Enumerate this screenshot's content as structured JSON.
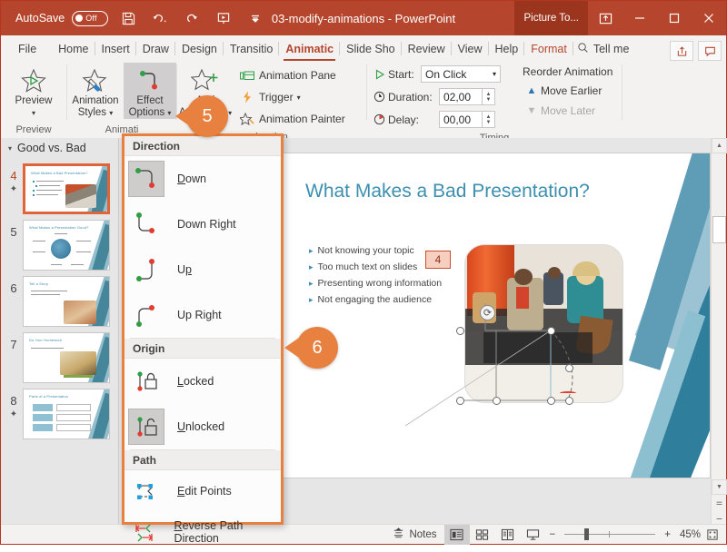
{
  "titlebar": {
    "autosave_label": "AutoSave",
    "autosave_state": "Off",
    "icons": [
      "save-icon",
      "undo-icon",
      "redo-icon",
      "start-slideshow-icon",
      "customize-quick-access-icon"
    ],
    "document_title": "03-modify-animations  -  PowerPoint",
    "contextual_tab": "Picture To...",
    "ribbon_display_options": "ribbon-display-icon",
    "minimize": "minimize-icon",
    "restore": "restore-icon",
    "close": "close-icon"
  },
  "tabs": [
    {
      "label": "File",
      "active": false
    },
    {
      "label": "Home",
      "active": false
    },
    {
      "label": "Insert",
      "active": false
    },
    {
      "label": "Draw",
      "active": false
    },
    {
      "label": "Design",
      "active": false
    },
    {
      "label": "Transitio",
      "active": false
    },
    {
      "label": "Animatic",
      "active": true
    },
    {
      "label": "Slide Sho",
      "active": false
    },
    {
      "label": "Review",
      "active": false
    },
    {
      "label": "View",
      "active": false
    },
    {
      "label": "Help",
      "active": false
    },
    {
      "label": "Format",
      "active": false,
      "contextual": true
    }
  ],
  "tellme": {
    "label": "Tell me",
    "icon": "search-icon",
    "share_icon": "share-icon",
    "comments_icon": "comments-icon"
  },
  "ribbon": {
    "groups": [
      {
        "name": "Preview",
        "label": "Preview",
        "buttons": [
          {
            "label": "Preview",
            "icon": "preview-star-icon",
            "dropdown": true
          }
        ]
      },
      {
        "name": "Animation",
        "label": "Animati",
        "buttons": [
          {
            "label": "Animation Styles",
            "icon": "animation-styles-icon",
            "dropdown": true
          },
          {
            "label": "Effect Options",
            "icon": "effect-options-icon",
            "dropdown": true,
            "selected": true
          }
        ]
      },
      {
        "name": "AdvancedAnimation",
        "label": "imation",
        "buttons": [
          {
            "label": "Add Animation",
            "icon": "add-animation-icon",
            "dropdown": true
          }
        ],
        "commands": [
          {
            "label": "Animation Pane",
            "icon": "animation-pane-icon"
          },
          {
            "label": "Trigger",
            "icon": "trigger-icon",
            "dropdown": true
          },
          {
            "label": "Animation Painter",
            "icon": "animation-painter-icon"
          }
        ]
      },
      {
        "name": "Timing",
        "label": "Timing",
        "fields": [
          {
            "label": "Start:",
            "value": "On Click",
            "icon": "play-icon",
            "type": "select"
          },
          {
            "label": "Duration:",
            "value": "02,00",
            "icon": "clock-icon",
            "type": "spinner"
          },
          {
            "label": "Delay:",
            "value": "00,00",
            "icon": "delay-clock-icon",
            "type": "spinner"
          }
        ],
        "reorder_title": "Reorder Animation",
        "reorder_items": [
          {
            "label": "Move Earlier",
            "icon": "chevron-up-icon",
            "disabled": false
          },
          {
            "label": "Move Later",
            "icon": "chevron-down-icon",
            "disabled": true
          }
        ]
      }
    ]
  },
  "slide_panel": {
    "section_title": "Good vs. Bad",
    "slides": [
      {
        "number": "4",
        "title": "What Makes a Bad Presentation?",
        "has_star": true,
        "active": true
      },
      {
        "number": "5",
        "title": "What Makes a Presentation Good?",
        "has_star": false,
        "active": false
      },
      {
        "number": "6",
        "title": "Tell a Story",
        "has_star": false,
        "active": false
      },
      {
        "number": "7",
        "title": "Do Your Homework",
        "has_star": false,
        "active": false
      },
      {
        "number": "8",
        "title": "Parts of a Presentation",
        "has_star": true,
        "active": false
      }
    ]
  },
  "slide": {
    "title": "What Makes a Bad Presentation?",
    "bullets": [
      "Not knowing your topic",
      "Too much text on slides",
      "Presenting wrong information",
      "Not engaging the audience"
    ],
    "animation_tag": "4",
    "rotate_handle": "rotate-icon"
  },
  "dropdown": {
    "sections": [
      {
        "header": "Direction",
        "items": [
          {
            "label": "Down",
            "accel": "D",
            "icon": "path-down-icon",
            "selected": true
          },
          {
            "label": "Down Right",
            "accel": "R",
            "icon": "path-down-right-icon",
            "selected": false
          },
          {
            "label": "Up",
            "accel": "p",
            "icon": "path-up-icon",
            "selected": false
          },
          {
            "label": "Up Right",
            "accel": "g",
            "icon": "path-up-right-icon",
            "selected": false
          }
        ]
      },
      {
        "header": "Origin",
        "items": [
          {
            "label": "Locked",
            "accel": "L",
            "icon": "lock-closed-icon",
            "selected": false
          },
          {
            "label": "Unlocked",
            "accel": "U",
            "icon": "lock-open-icon",
            "selected": true
          }
        ]
      },
      {
        "header": "Path",
        "items": [
          {
            "label": "Edit Points",
            "accel": "E",
            "icon": "edit-points-icon",
            "selected": false
          },
          {
            "label": "Reverse Path Direction",
            "accel": "R",
            "icon": "reverse-path-icon",
            "selected": false
          }
        ]
      }
    ]
  },
  "callouts": [
    {
      "number": "5"
    },
    {
      "number": "6"
    }
  ],
  "statusbar": {
    "notes_label": "Notes",
    "notes_icon": "notes-icon",
    "views": [
      {
        "name": "normal-view",
        "icon": "normal-view-icon",
        "active": true
      },
      {
        "name": "slide-sorter-view",
        "icon": "slide-sorter-icon",
        "active": false
      },
      {
        "name": "reading-view",
        "icon": "reading-view-icon",
        "active": false
      },
      {
        "name": "slide-show-view",
        "icon": "slide-show-icon",
        "active": false
      }
    ],
    "zoom_out": "−",
    "zoom_in": "+",
    "zoom_level": "45%",
    "fit_icon": "fit-slide-icon"
  },
  "colors": {
    "brand": "#b5452c",
    "accent_orange": "#e8803f",
    "slide_title_blue": "#3d8fb0",
    "green_marker": "#3faa3f",
    "red_marker": "#e03c31"
  }
}
